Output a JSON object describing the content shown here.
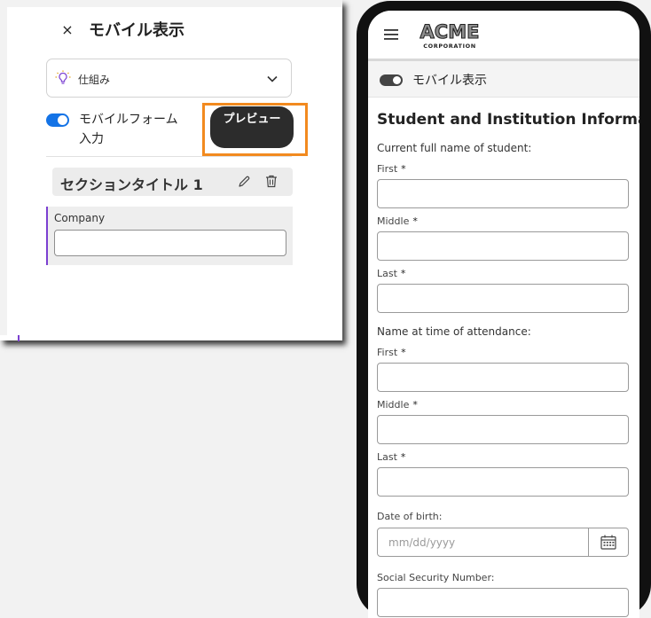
{
  "panel": {
    "close_glyph": "×",
    "title": "モバイル表示",
    "dropdown": {
      "selected": "仕組み",
      "icon": "lightbulb-icon",
      "chevron": "chevron-down-icon"
    },
    "mobile_form_toggle": {
      "label": "モバイルフォーム入力",
      "on": true
    },
    "preview_button": "プレビュー",
    "section": {
      "title": "セクションタイトル 1",
      "edit_icon": "pencil-icon",
      "delete_icon": "trash-icon"
    },
    "field": {
      "label": "Company",
      "value": ""
    }
  },
  "phone": {
    "header": {
      "menu_icon": "hamburger-icon",
      "logo_text": "ACME",
      "logo_sub": "CORPORATION"
    },
    "mobile_view_toggle": {
      "label": "モバイル表示",
      "on": true
    },
    "form": {
      "title": "Student and Institution Information",
      "current_name": {
        "label": "Current full name of student:",
        "first": "First",
        "middle": "Middle",
        "last": "Last"
      },
      "attendance_name": {
        "label": "Name at time of attendance:",
        "first": "First",
        "middle": "Middle",
        "last": "Last"
      },
      "dob": {
        "label": "Date of birth:",
        "placeholder": "mm/dd/yyyy",
        "icon": "calendar-icon"
      },
      "ssn": {
        "label": "Social Security Number:"
      },
      "required_marker": "*"
    }
  },
  "colors": {
    "accent_blue": "#1473e6",
    "highlight_orange": "#f28a1f",
    "field_border_purple": "#7b3fd1",
    "dark_button": "#2c2c2c"
  }
}
